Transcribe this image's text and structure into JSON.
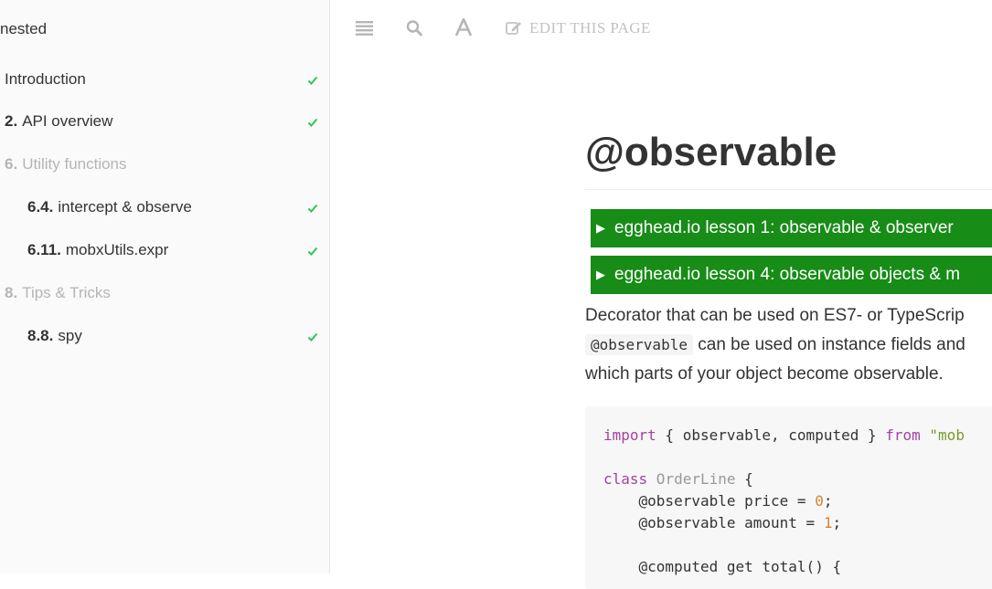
{
  "sidebar": {
    "title": "nested",
    "items": [
      {
        "number": "",
        "label": "Introduction",
        "checked": true,
        "muted": false
      },
      {
        "number": "2.",
        "label": "API overview",
        "checked": true,
        "muted": false
      },
      {
        "number": "6.",
        "label": "Utility functions",
        "checked": false,
        "muted": true
      },
      {
        "number": "6.4.",
        "label": "intercept & observe",
        "checked": true,
        "muted": false
      },
      {
        "number": "6.11.",
        "label": "mobxUtils.expr",
        "checked": true,
        "muted": false
      },
      {
        "number": "8.",
        "label": "Tips & Tricks",
        "checked": false,
        "muted": true
      },
      {
        "number": "8.8.",
        "label": "spy",
        "checked": true,
        "muted": false
      }
    ]
  },
  "toolbar": {
    "icons": [
      "list-icon",
      "search-icon",
      "font-icon",
      "edit-icon"
    ],
    "edit_label": "EDIT THIS PAGE"
  },
  "page": {
    "title": "@observable",
    "lessons": [
      "egghead.io lesson 1: observable & observer",
      "egghead.io lesson 4: observable objects & m"
    ],
    "paragraph": {
      "line1": "Decorator that can be used on ES7- or TypeScrip",
      "line2_code": "@observable",
      "line2_text": " can be used on instance fields and",
      "line3": "which parts of your object become observable."
    },
    "code": {
      "l1_kw": "import",
      "l1_mid": " { observable, computed } ",
      "l1_from": "from",
      "l1_str": " \"mob",
      "l2_kw": "class",
      "l2_name": " OrderLine",
      "l2_rest": " {",
      "l3_pre": "    @observable price = ",
      "l3_num": "0",
      "l3_post": ";",
      "l4_pre": "    @observable amount = ",
      "l4_num": "1",
      "l4_post": ";",
      "l5": "    @computed get total() {"
    }
  },
  "colors": {
    "lesson_bg": "#178c17",
    "check": "#2ec55a",
    "keyword": "#a342a3",
    "number": "#e0802c",
    "string": "#7a9a2a"
  }
}
